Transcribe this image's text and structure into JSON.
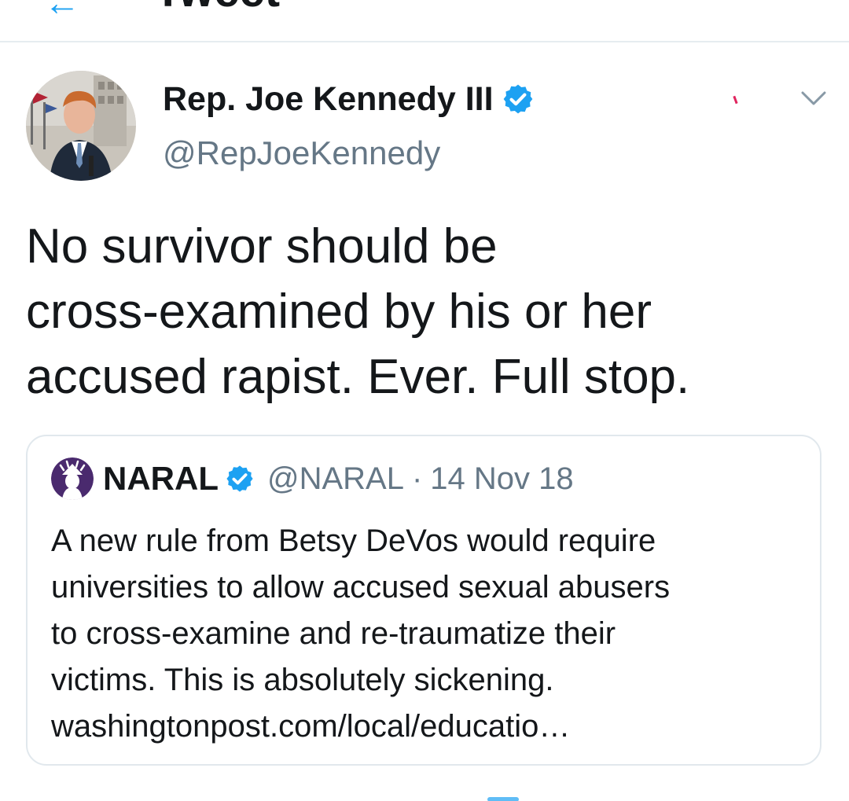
{
  "header": {
    "title": "Tweet",
    "back_icon": "arrow-left-icon"
  },
  "tweet": {
    "author_name": "Rep. Joe Kennedy III",
    "author_handle": "@RepJoeKennedy",
    "verified_icon": "verified-badge-icon",
    "menu_icon": "chevron-down-icon",
    "text": "No survivor should be\ncross-examined by his or her\naccused rapist. Ever. Full stop."
  },
  "quoted_tweet": {
    "author_name": "NARAL",
    "author_handle": "@NARAL",
    "separator": "·",
    "date": "14 Nov 18",
    "verified_icon": "verified-badge-icon",
    "text_lines": [
      "A new rule from Betsy DeVos would require",
      "universities to allow accused sexual abusers",
      "to cross-examine and re-traumatize their",
      "victims. This is absolutely sickening.",
      "washingtonpost.com/local/educatio…"
    ]
  },
  "colors": {
    "accent": "#1da1f2",
    "secondary_text": "#657786",
    "border": "#e1e8ed",
    "text": "#14171a"
  }
}
